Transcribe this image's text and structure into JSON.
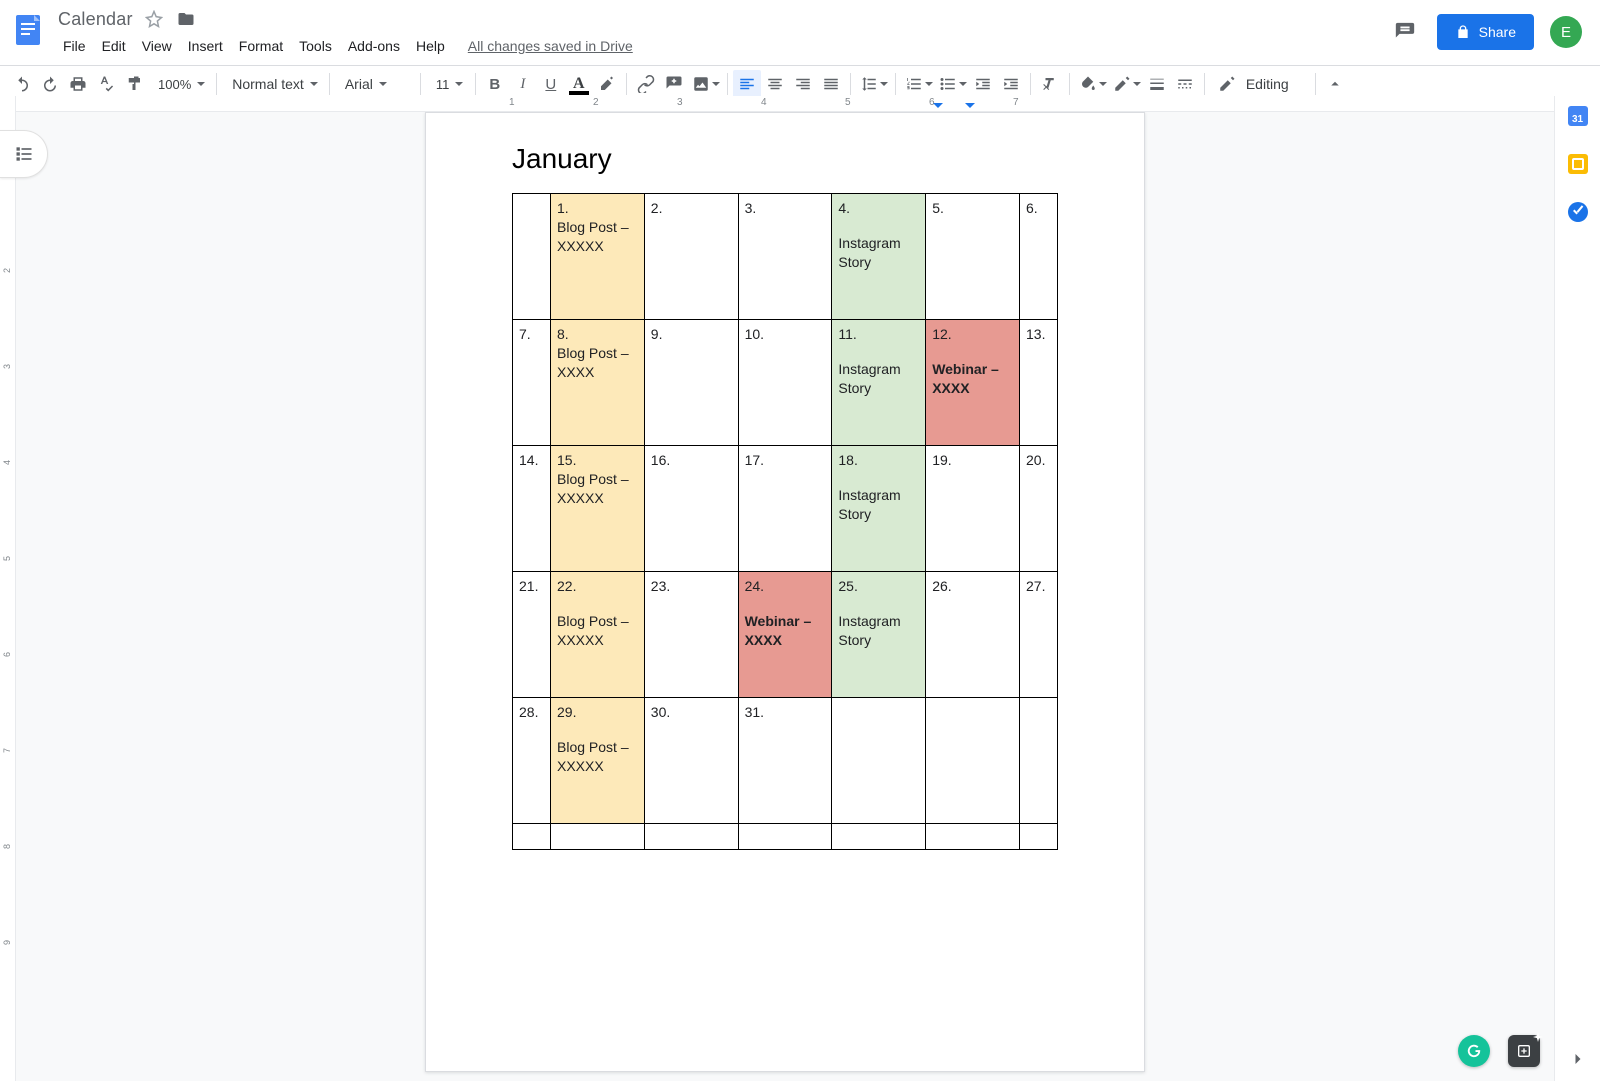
{
  "header": {
    "doc_title": "Calendar",
    "save_state": "All changes saved in Drive",
    "share_label": "Share",
    "avatar_letter": "E",
    "menu": [
      "File",
      "Edit",
      "View",
      "Insert",
      "Format",
      "Tools",
      "Add-ons",
      "Help"
    ]
  },
  "toolbar": {
    "zoom": "100%",
    "style": "Normal text",
    "font": "Arial",
    "font_size": "11",
    "mode": "Editing"
  },
  "sidepanel": {
    "calendar_day": "31"
  },
  "document": {
    "heading": "January",
    "colors": {
      "yellow": "#fde9b9",
      "green": "#d8ead2",
      "red": "#e79a92"
    },
    "rows": [
      [
        {
          "num": "",
          "text": "",
          "bg": "",
          "bold": false
        },
        {
          "num": "1.",
          "text": "Blog Post  – XXXXX",
          "bg": "yellow",
          "textgap": false,
          "bold": false
        },
        {
          "num": "2.",
          "text": "",
          "bg": "",
          "bold": false
        },
        {
          "num": "3.",
          "text": "",
          "bg": "",
          "bold": false
        },
        {
          "num": "4.",
          "text": "Instagram Story",
          "bg": "green",
          "textgap": true,
          "bold": false
        },
        {
          "num": "5.",
          "text": "",
          "bg": "",
          "bold": false
        },
        {
          "num": "6.",
          "text": "",
          "bg": "",
          "bold": false
        }
      ],
      [
        {
          "num": "7.",
          "text": "",
          "bg": "",
          "bold": false
        },
        {
          "num": "8.",
          "text": "Blog Post – XXXX",
          "bg": "yellow",
          "textgap": false,
          "bold": false
        },
        {
          "num": "9.",
          "text": "",
          "bg": "",
          "bold": false
        },
        {
          "num": "10.",
          "text": "",
          "bg": "",
          "bold": false
        },
        {
          "num": "11.",
          "text": "Instagram Story",
          "bg": "green",
          "textgap": true,
          "bold": false
        },
        {
          "num": "12.",
          "text": "Webinar – XXXX",
          "bg": "red",
          "textgap": true,
          "bold": true
        },
        {
          "num": "13.",
          "text": "",
          "bg": "",
          "bold": false
        }
      ],
      [
        {
          "num": "14.",
          "text": "",
          "bg": "",
          "bold": false
        },
        {
          "num": "15.",
          "text": "Blog Post  – XXXXX",
          "bg": "yellow",
          "textgap": false,
          "bold": false
        },
        {
          "num": "16.",
          "text": "",
          "bg": "",
          "bold": false
        },
        {
          "num": "17.",
          "text": "",
          "bg": "",
          "bold": false
        },
        {
          "num": "18.",
          "text": "Instagram Story",
          "bg": "green",
          "textgap": true,
          "bold": false
        },
        {
          "num": "19.",
          "text": "",
          "bg": "",
          "bold": false
        },
        {
          "num": "20.",
          "text": "",
          "bg": "",
          "bold": false
        }
      ],
      [
        {
          "num": "21.",
          "text": "",
          "bg": "",
          "bold": false
        },
        {
          "num": "22.",
          "text": "Blog Post  – XXXXX",
          "bg": "yellow",
          "textgap": true,
          "bold": false
        },
        {
          "num": "23.",
          "text": "",
          "bg": "",
          "bold": false
        },
        {
          "num": "24.",
          "text": "Webinar – XXXX",
          "bg": "red",
          "textgap": true,
          "bold": true
        },
        {
          "num": "25.",
          "text": "Instagram Story",
          "bg": "green",
          "textgap": true,
          "bold": false
        },
        {
          "num": "26.",
          "text": "",
          "bg": "",
          "bold": false
        },
        {
          "num": "27.",
          "text": "",
          "bg": "",
          "bold": false
        }
      ],
      [
        {
          "num": "28.",
          "text": "",
          "bg": "",
          "bold": false
        },
        {
          "num": "29.",
          "text": "Blog Post  – XXXXX",
          "bg": "yellow",
          "textgap": true,
          "bold": false
        },
        {
          "num": "30.",
          "text": "",
          "bg": "",
          "bold": false
        },
        {
          "num": "31.",
          "text": "",
          "bg": "",
          "bold": false
        },
        {
          "num": "",
          "text": "",
          "bg": "",
          "bold": false
        },
        {
          "num": "",
          "text": "",
          "bg": "",
          "bold": false
        },
        {
          "num": "",
          "text": "",
          "bg": "",
          "bold": false
        }
      ]
    ]
  }
}
